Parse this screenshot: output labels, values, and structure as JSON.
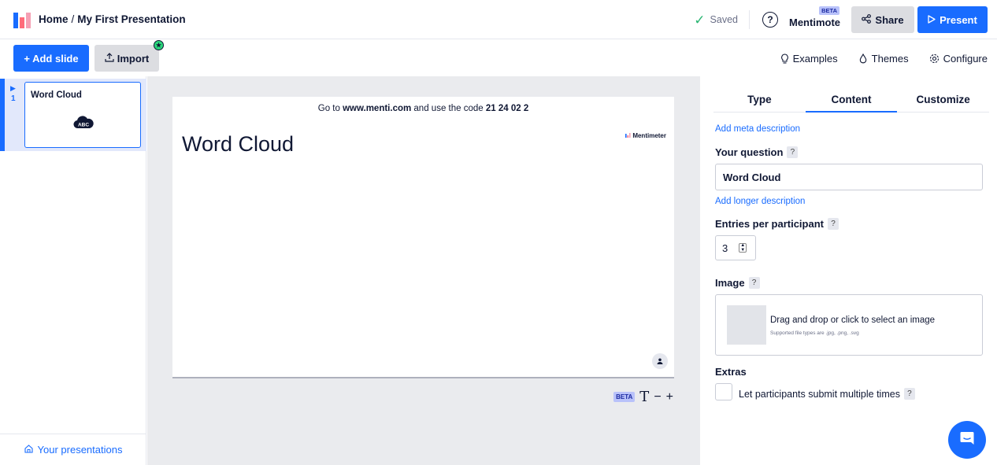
{
  "header": {
    "home": "Home",
    "separator": "/",
    "presentation_title": "My First Presentation",
    "saved_label": "Saved",
    "help": "?",
    "mentimote_label": "Mentimote",
    "mentimote_badge": "BETA",
    "share_label": "Share",
    "present_label": "Present"
  },
  "toolbar": {
    "add_slide_label": "+ Add slide",
    "import_label": "Import",
    "examples_label": "Examples",
    "themes_label": "Themes",
    "configure_label": "Configure"
  },
  "slides": [
    {
      "number": "1",
      "title": "Word Cloud",
      "icon": "word-cloud-icon",
      "icon_text": "ABC"
    }
  ],
  "sidebar": {
    "your_presentations_label": "Your presentations"
  },
  "slide": {
    "join_prefix": "Go to ",
    "join_url": "www.menti.com",
    "join_middle": " and use the code ",
    "join_code": "21 24 02 2",
    "brand": "Mentimeter",
    "title": "Word Cloud"
  },
  "font_controls": {
    "badge": "BETA",
    "glyph": "T",
    "minus": "−",
    "plus": "+"
  },
  "panel": {
    "tabs": [
      "Type",
      "Content",
      "Customize"
    ],
    "active_tab": "Content",
    "add_meta_description": "Add meta description",
    "question_label": "Your question",
    "question_value": "Word Cloud",
    "add_longer_description": "Add longer description",
    "entries_label": "Entries per participant",
    "entries_value": "3",
    "image_label": "Image",
    "image_drop_text": "Drag and drop or click to select an image",
    "image_drop_sub": "Supported file types are .jpg, .png, .svg",
    "extras_label": "Extras",
    "multiple_submit_label": "Let participants submit multiple times",
    "help_mark": "?"
  },
  "colors": {
    "accent": "#196cff",
    "selected_bg": "#e2e8fb",
    "saved_check": "#2bb673",
    "import_dot": "#2bd67b"
  }
}
